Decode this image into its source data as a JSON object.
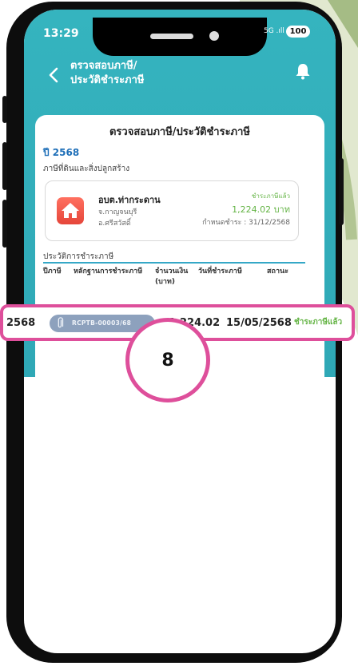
{
  "status_bar": {
    "time": "13:29",
    "signal": "5G .ıll",
    "battery": "100"
  },
  "nav": {
    "title_line1": "ตรวจสอบภาษี/",
    "title_line2": "ประวัติชำระภาษี"
  },
  "card": {
    "title": "ตรวจสอบภาษี/ประวัติชำระภาษี",
    "year_label": "ปี 2568",
    "section_label": "ภาษีที่ดินและสิ่งปลูกสร้าง",
    "property": {
      "name": "อบต.ท่ากระดาน",
      "province": "จ.กาญจนบุรี",
      "district": "อ.ศรีสวัสดิ์",
      "pay_status": "ชำระภาษีแล้ว",
      "amount": "1,224.02 บาท",
      "due_date": "กำหนดชำระ : 31/12/2568"
    },
    "history_label": "ประวัติการชำระภาษี",
    "columns": [
      "ปีภาษี",
      "หลักฐานการชำระภาษี",
      "จำนวนเงิน (บาท)",
      "วันที่ชำระภาษี",
      "สถานะ"
    ]
  },
  "history_row": {
    "year": "2568",
    "receipt": "RCPTB-00003/68",
    "amount": "1,224.02",
    "date": "15/05/2568",
    "status": "ชำระภาษีแล้ว"
  },
  "step_badge": "8",
  "colors": {
    "header": "#35b4bf",
    "highlight": "#de4f9b",
    "paid_green": "#64b445",
    "year_blue": "#1e6fb8",
    "receipt_pill": "#8da1bd"
  }
}
